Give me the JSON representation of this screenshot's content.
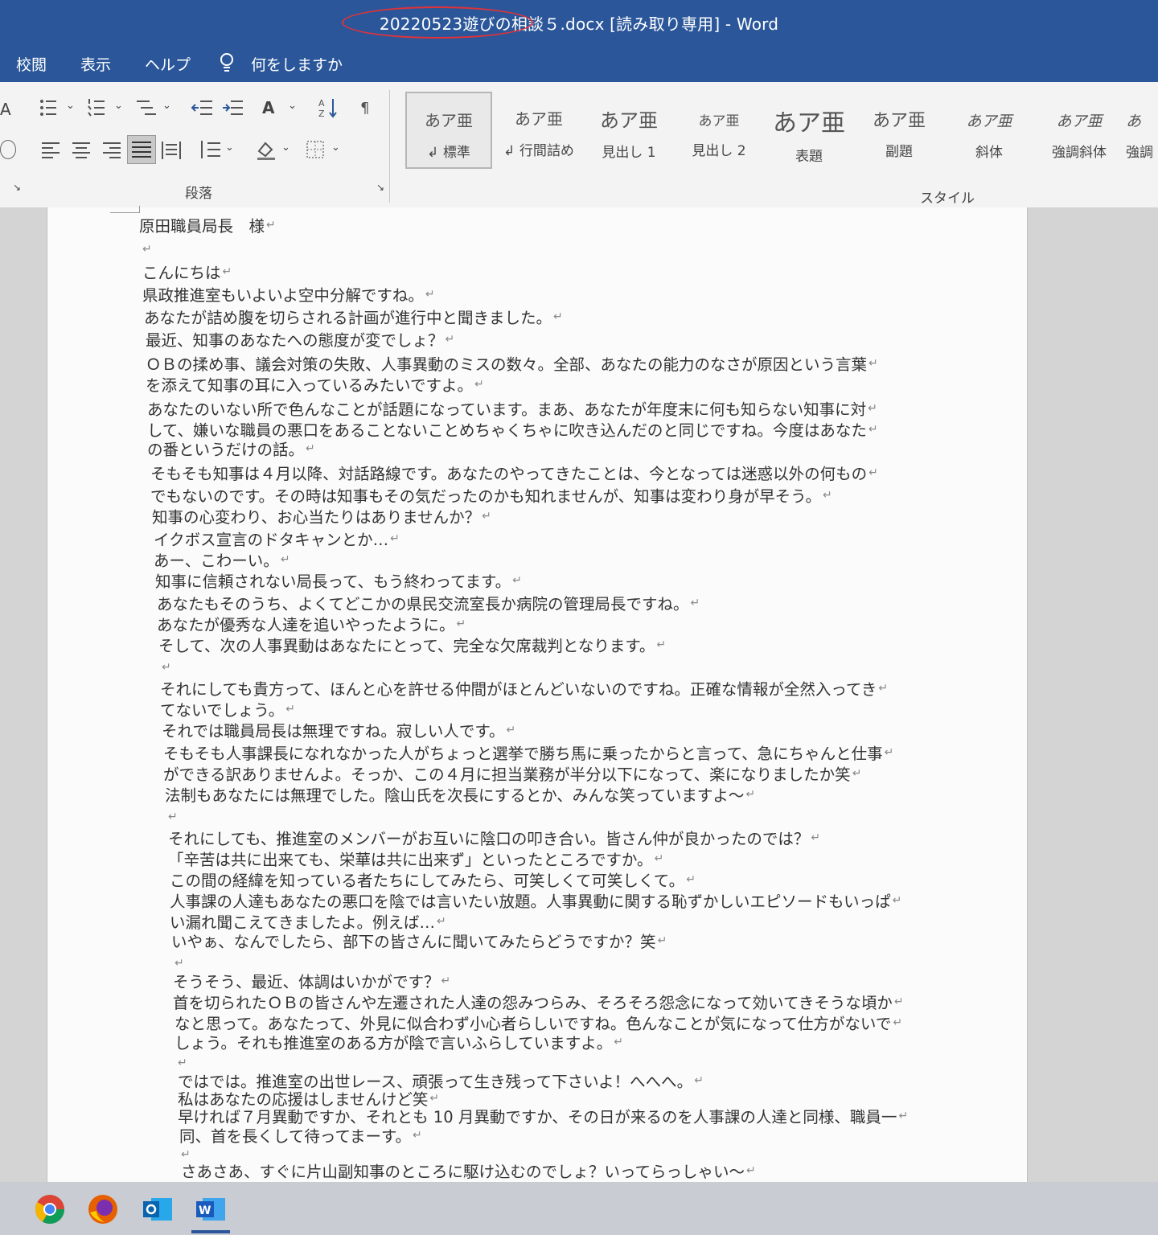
{
  "window": {
    "title": "20220523遊びの相談５.docx [読み取り専用]  -  Word"
  },
  "menu": {
    "items": [
      "校閲",
      "表示",
      "ヘルプ"
    ],
    "search_label": "何をしますか"
  },
  "ribbon": {
    "paragraph_label": "段落",
    "styles_label": "スタイル",
    "styles": [
      {
        "sample": "あア亜",
        "name": "↲ 標準"
      },
      {
        "sample": "あア亜",
        "name": "↲ 行間詰め"
      },
      {
        "sample": "あア亜",
        "name": "見出し 1"
      },
      {
        "sample": "あア亜",
        "name": "見出し 2"
      },
      {
        "sample": "あア亜",
        "name": "表題"
      },
      {
        "sample": "あア亜",
        "name": "副題"
      },
      {
        "sample": "あア亜",
        "name": "斜体"
      },
      {
        "sample": "あア亜",
        "name": "強調斜体"
      },
      {
        "sample": "あ",
        "name": "強調"
      }
    ]
  },
  "document": {
    "lines": [
      "原田職員局長　様",
      "",
      "こんにちは",
      "県政推進室もいよいよ空中分解ですね。",
      "あなたが詰め腹を切らされる計画が進行中と聞きました。",
      "最近、知事のあなたへの態度が変でしょ？",
      "ＯＢの揉め事、議会対策の失敗、人事異動のミスの数々。全部、あなたの能力のなさが原因という言葉",
      "を添えて知事の耳に入っているみたいですよ。",
      "あなたのいない所で色んなことが話題になっています。まあ、あなたが年度末に何も知らない知事に対",
      "して、嫌いな職員の悪口をあることないことめちゃくちゃに吹き込んだのと同じですね。今度はあなた",
      "の番というだけの話。",
      "そもそも知事は４月以降、対話路線です。あなたのやってきたことは、今となっては迷惑以外の何もの",
      "でもないのです。その時は知事もその気だったのかも知れませんが、知事は変わり身が早そう。",
      "知事の心変わり、お心当たりはありませんか？",
      "イクボス宣言のドタキャンとか…",
      "あー、こわーい。",
      "知事に信頼されない局長って、もう終わってます。",
      "あなたもそのうち、よくてどこかの県民交流室長か病院の管理局長ですね。",
      "あなたが優秀な人達を追いやったように。",
      "そして、次の人事異動はあなたにとって、完全な欠席裁判となります。",
      "",
      "それにしても貴方って、ほんと心を許せる仲間がほとんどいないのですね。正確な情報が全然入ってき",
      "てないでしょう。",
      "それでは職員局長は無理ですね。寂しい人です。",
      "そもそも人事課長になれなかった人がちょっと選挙で勝ち馬に乗ったからと言って、急にちゃんと仕事",
      "ができる訳ありませんよ。そっか、この４月に担当業務が半分以下になって、楽になりましたか笑",
      "法制もあなたには無理でした。陰山氏を次長にするとか、みんな笑っていますよ～",
      "",
      "それにしても、推進室のメンバーがお互いに陰口の叩き合い。皆さん仲が良かったのでは？",
      "「辛苦は共に出来ても、栄華は共に出来ず」といったところですか。",
      "この間の経緯を知っている者たちにしてみたら、可笑しくて可笑しくて。",
      "人事課の人達もあなたの悪口を陰では言いたい放題。人事異動に関する恥ずかしいエピソードもいっぱ",
      "い漏れ聞こえてきましたよ。例えば…",
      "いやぁ、なんでしたら、部下の皆さんに聞いてみたらどうですか？笑",
      "",
      "そうそう、最近、体調はいかがです？",
      "首を切られたＯＢの皆さんや左遷された人達の怨みつらみ、そろそろ怨念になって効いてきそうな頃か",
      "なと思って。あなたって、外見に似合わず小心者らしいですね。色んなことが気になって仕方がないで",
      "しょう。それも推進室のある方が陰で言いふらしていますよ。",
      "",
      "ではでは。推進室の出世レース、頑張って生き残って下さいよ！へへへ。",
      "私はあなたの応援はしませんけど笑",
      "早ければ７月異動ですか、それとも 10 月異動ですか、その日が来るのを人事課の人達と同様、職員一",
      "同、首を長くして待ってまーす。",
      "",
      "さあさあ、すぐに片山副知事のところに駆け込むのでしょ？いってらっしゃい～"
    ]
  },
  "taskbar": {
    "apps": [
      "chrome-icon",
      "firefox-icon",
      "outlook-icon",
      "word-icon"
    ]
  },
  "colors": {
    "titlebar": "#2b579a",
    "annotation_ellipse": "#e0323a"
  }
}
